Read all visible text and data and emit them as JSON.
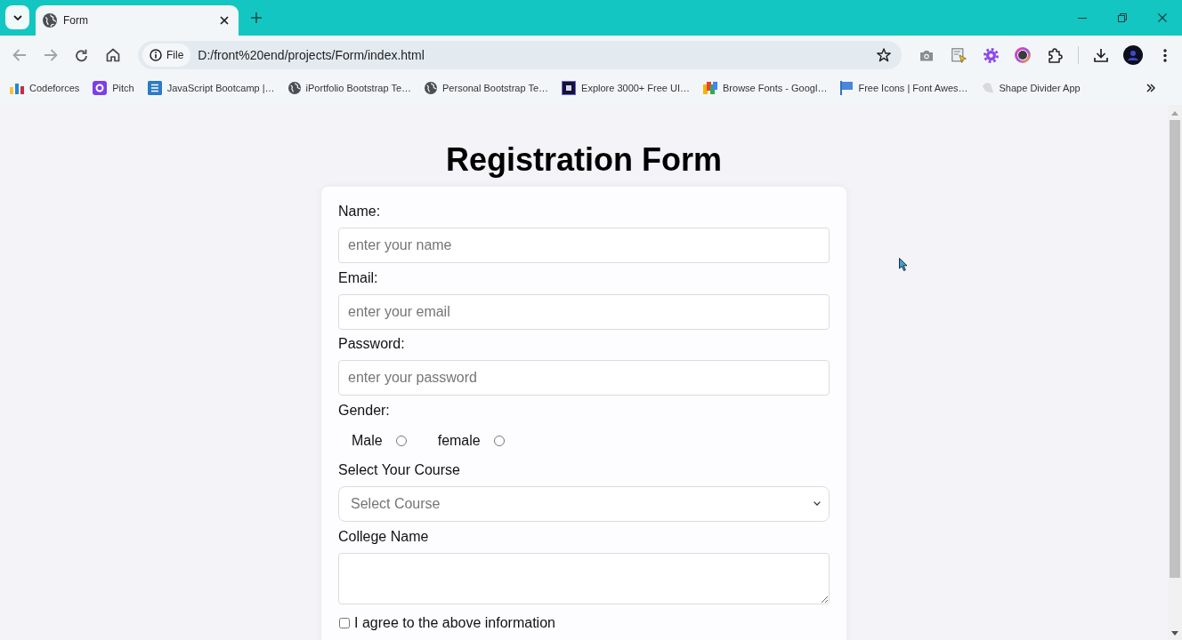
{
  "browser": {
    "tabs": [
      {
        "title": "Form",
        "selected": true
      }
    ],
    "address_bar": {
      "chip": "File",
      "url": "D:/front%20end/projects/Form/index.html"
    },
    "bookmarks": [
      {
        "label": "Codeforces"
      },
      {
        "label": "Pitch"
      },
      {
        "label": "JavaScript Bootcamp |…"
      },
      {
        "label": "iPortfolio Bootstrap Te…"
      },
      {
        "label": "Personal Bootstrap Te…"
      },
      {
        "label": "Explore 3000+ Free UI…"
      },
      {
        "label": "Browse Fonts - Googl…"
      },
      {
        "label": "Free Icons | Font Awes…"
      },
      {
        "label": "Shape Divider App"
      }
    ]
  },
  "page": {
    "title": "Registration Form",
    "fields": [
      {
        "kind": "input",
        "label": "Name:",
        "placeholder": "enter your name"
      },
      {
        "kind": "input",
        "label": "Email:",
        "placeholder": "enter your email"
      },
      {
        "kind": "input",
        "label": "Password:",
        "placeholder": "enter your password"
      },
      {
        "kind": "radio",
        "label": "Gender:",
        "options": [
          {
            "label": "Male",
            "selected": false
          },
          {
            "label": "female",
            "selected": false
          }
        ]
      },
      {
        "kind": "select",
        "label": "Select Your Course",
        "placeholder": "Select Course"
      },
      {
        "kind": "textarea",
        "label": "College Name"
      },
      {
        "kind": "checkbox",
        "label": "I agree to the above information",
        "checked": false
      }
    ]
  }
}
